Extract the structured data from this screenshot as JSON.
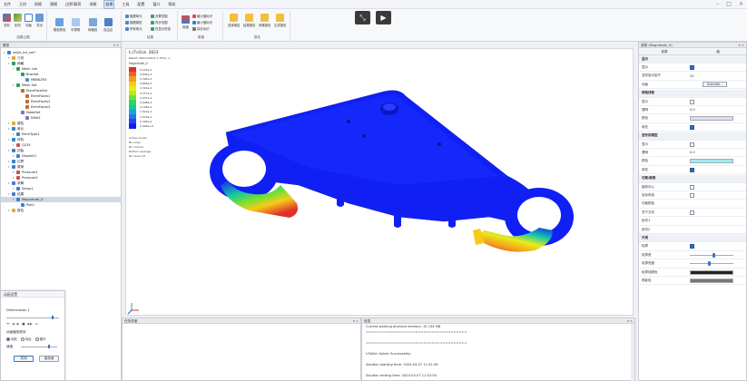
{
  "menubar": {
    "items": [
      "文件",
      "几何",
      "网格",
      "建模",
      "边界/载荷",
      "求解",
      "结果",
      "工具",
      "配置",
      "窗口",
      "帮助"
    ],
    "active_index": 6
  },
  "ribbon": {
    "groups": [
      {
        "label": "结果云图",
        "buttons": [
          "变形",
          "剖切",
          "动画",
          "导出"
        ]
      },
      {
        "label": "",
        "buttons": [
          "模型着色",
          "半透明",
          "网格线",
          "自由边"
        ]
      },
      {
        "label": "结果",
        "small": [
          "隐藏单元",
          "隐藏模型",
          "所有单元",
          "设置范围",
          "同步范围",
          "仅显示所选"
        ]
      },
      {
        "label": "极值",
        "small": [
          "最大值标识",
          "最小值标识",
          "探针标识"
        ],
        "buttons": [
          "极值"
        ]
      },
      {
        "label": "报告",
        "buttons": [
          "选择报告",
          "结果报告",
          "网格报告",
          "生成报告"
        ]
      }
    ]
  },
  "model_tree": {
    "title": "模型",
    "items": [
      {
        "label": "shijie_tm_sm*",
        "level": 0,
        "color": "#3b7fd0"
      },
      {
        "label": "几何",
        "level": 1,
        "color": "#e2a73a"
      },
      {
        "label": "网格",
        "level": 1,
        "color": "#2a9c5c"
      },
      {
        "label": "Mesh List",
        "level": 2,
        "color": "#2a9c5c"
      },
      {
        "label": "Bracket",
        "level": 3,
        "color": "#2a9c5c"
      },
      {
        "label": "M8BK2R3",
        "level": 4,
        "color": "#4a90c8"
      },
      {
        "label": "Mesh Set",
        "level": 2,
        "color": "#2a9c5c"
      },
      {
        "label": "ElemFaceSet",
        "level": 3,
        "color": "#c46a2b"
      },
      {
        "label": "ElemFaces1",
        "level": 4,
        "color": "#c46a2b"
      },
      {
        "label": "ElemFaces2",
        "level": 4,
        "color": "#c46a2b"
      },
      {
        "label": "ElemFaces3",
        "level": 4,
        "color": "#c46a2b"
      },
      {
        "label": "NodeSet",
        "level": 3,
        "color": "#8a6ac8"
      },
      {
        "label": "NSet1",
        "level": 4,
        "color": "#8a6ac8"
      },
      {
        "label": "属性",
        "level": 1,
        "color": "#e2a73a"
      },
      {
        "label": "单元",
        "level": 1,
        "color": "#3b7fd0"
      },
      {
        "label": "ElemType1",
        "level": 2,
        "color": "#3b7fd0"
      },
      {
        "label": "材料",
        "level": 1,
        "color": "#3b7fd0"
      },
      {
        "label": "Q235",
        "level": 2,
        "color": "#d04a4a"
      },
      {
        "label": "初始",
        "level": 1,
        "color": "#3b7fd0"
      },
      {
        "label": "Displmt1",
        "level": 2,
        "color": "#3b7fd0"
      },
      {
        "label": "边界",
        "level": 1,
        "color": "#3b7fd0"
      },
      {
        "label": "载荷",
        "level": 1,
        "color": "#3b7fd0"
      },
      {
        "label": "Pressure1",
        "level": 2,
        "color": "#d04a4a"
      },
      {
        "label": "Pressure2",
        "level": 2,
        "color": "#d04a4a"
      },
      {
        "label": "求解",
        "level": 1,
        "color": "#3b7fd0"
      },
      {
        "label": "Setup1",
        "level": 2,
        "color": "#3b7fd0"
      },
      {
        "label": "结果",
        "level": 1,
        "color": "#3b7fd0"
      },
      {
        "label": "Magnitude_U",
        "level": 2,
        "color": "#3b7fd0",
        "selected": true
      },
      {
        "label": "Plot1",
        "level": 3,
        "color": "#3b7fd0"
      },
      {
        "label": "报告",
        "level": 1,
        "color": "#e2a73a"
      }
    ]
  },
  "viewport": {
    "app_title": "LiToSim 2023",
    "info_line": "Result: Deformation 1  Time: 1",
    "legend_title": "Magnitude_U",
    "legend_values": [
      "6.474e-1",
      "5.934e-1",
      "5.395e-1",
      "4.856e-1",
      "4.316e-1",
      "3.777e-1",
      "3.237e-1",
      "2.698e-1",
      "2.158e-1",
      "1.619e-1",
      "1.079e-1",
      "5.395e-2",
      "0.000e+0"
    ],
    "legend_colors": [
      "#e0302a",
      "#ee6326",
      "#f59a1f",
      "#f6cc1a",
      "#e9ec17",
      "#b4ea1f",
      "#6fe034",
      "#2fd565",
      "#14c7a4",
      "#1ba4d6",
      "#2a72e8",
      "#2447f0",
      "#1020f5"
    ],
    "notes": [
      "Active model",
      "No scale",
      "No contour",
      "Bottom average",
      "No Level 1D"
    ]
  },
  "properties": {
    "title": "参数 (Magnitude_U)",
    "col_name": "参数",
    "col_value": "值",
    "rows": [
      {
        "type": "section",
        "name": "显示"
      },
      {
        "type": "check",
        "name": "显示",
        "on": true
      },
      {
        "type": "text",
        "name": "变形放大因子",
        "value": "20"
      },
      {
        "type": "button",
        "name": "动画",
        "value": "Animate..."
      },
      {
        "type": "section",
        "name": "网格线框"
      },
      {
        "type": "check",
        "name": "显示",
        "on": false
      },
      {
        "type": "text",
        "name": "透明",
        "value": "0.0"
      },
      {
        "type": "color",
        "name": "颜色",
        "value": "#dadcf7"
      },
      {
        "type": "check",
        "name": "填充",
        "on": true
      },
      {
        "type": "section",
        "name": "变形前模型"
      },
      {
        "type": "check",
        "name": "显示",
        "on": false
      },
      {
        "type": "text",
        "name": "透明",
        "value": "0.0"
      },
      {
        "type": "color",
        "name": "颜色",
        "value": "#9ee9f5"
      },
      {
        "type": "check",
        "name": "填充",
        "on": true
      },
      {
        "type": "section",
        "name": "切面/截面"
      },
      {
        "type": "check",
        "name": "旋转中心",
        "on": false
      },
      {
        "type": "check",
        "name": "坐标系统",
        "on": false
      },
      {
        "type": "text",
        "name": "切面颜色",
        "value": ""
      },
      {
        "type": "check",
        "name": "关于方向",
        "on": false
      },
      {
        "type": "text",
        "name": "剖切1",
        "value": ""
      },
      {
        "type": "text",
        "name": "剖切2",
        "value": ""
      },
      {
        "type": "section",
        "name": "外观"
      },
      {
        "type": "check",
        "name": "轮廓",
        "on": true
      },
      {
        "type": "slider",
        "name": "轮廓宽",
        "level": 0.55
      },
      {
        "type": "slider",
        "name": "轮廓亮度",
        "level": 0.45
      },
      {
        "type": "color",
        "name": "轮廓线颜色",
        "value": "#222222"
      },
      {
        "type": "color",
        "name": "阴影色",
        "value": "#777777"
      }
    ]
  },
  "task_panel": {
    "title": "任务进度"
  },
  "output": {
    "title": "信息",
    "lines": [
      "Current working physical memory: 10 134 MB",
      "=====================================",
      "",
      "=====================================",
      "",
      "LiToSim Solver Successfully.",
      "",
      "Solution starting time: 2024-03-07 11:51:56",
      "",
      "Solution ending time: 2024-03-07 11:52:00"
    ]
  },
  "animation_dialog": {
    "title": "动画设置",
    "result_name": "Deformation 1",
    "mode_label": "动画播放顺序",
    "modes": [
      "向前",
      "向后",
      "循环"
    ],
    "selected_mode": 0,
    "speed_label": "速度",
    "frame_level": 0.9,
    "speed_level": 0.8,
    "close_label": "关闭",
    "save_label": "保存帧"
  },
  "colors": {
    "accent": "#2a6fbf",
    "model_blue": "#1020f5"
  }
}
